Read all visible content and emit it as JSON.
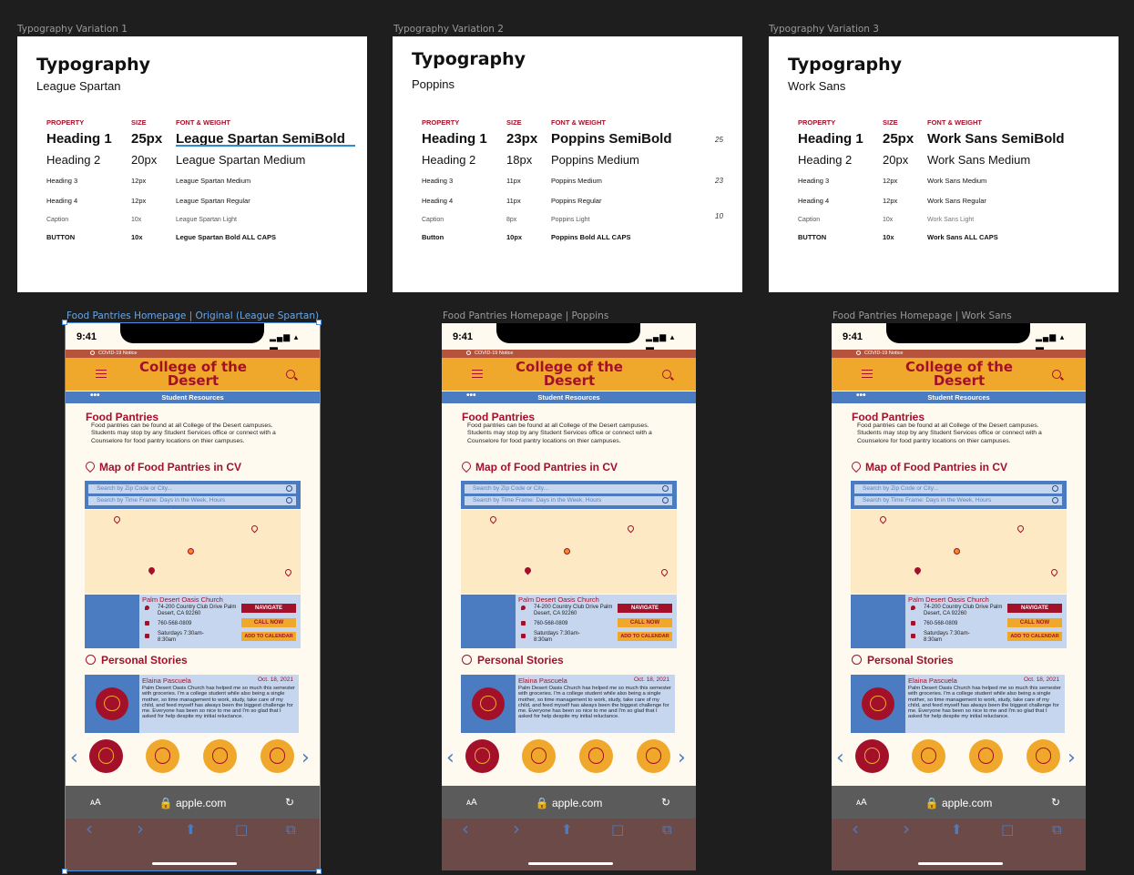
{
  "frames": {
    "typo1": "Typography Variation 1",
    "typo2": "Typography Variation 2",
    "typo3": "Typography Variation 3",
    "phone1": "Food Pantries Homepage | Original (League Spartan)",
    "phone2": "Food Pantries Homepage | Poppins",
    "phone3": "Food Pantries Homepage | Work Sans"
  },
  "cards": [
    {
      "title": "Typography",
      "font": "League Spartan",
      "headers": [
        "PROPERTY",
        "SIZE",
        "FONT & WEIGHT"
      ],
      "rows": [
        [
          "Heading 1",
          "25px",
          "League Spartan SemiBold"
        ],
        [
          "Heading 2",
          "20px",
          "League Spartan Medium"
        ],
        [
          "Heading 3",
          "12px",
          "League Spartan Medium"
        ],
        [
          "Heading 4",
          "12px",
          "League Spartan Regular"
        ],
        [
          "Caption",
          "10x",
          "League Spartan Light"
        ],
        [
          "BUTTON",
          "10x",
          "Legue Spartan Bold ALL CAPS"
        ]
      ],
      "notes": []
    },
    {
      "title": "Typography",
      "font": "Poppins",
      "headers": [
        "PROPERTY",
        "SIZE",
        "FONT & WEIGHT"
      ],
      "rows": [
        [
          "Heading 1",
          "23px",
          "Poppins SemiBold"
        ],
        [
          "Heading 2",
          "18px",
          "Poppins Medium"
        ],
        [
          "Heading 3",
          "11px",
          "Poppins Medium"
        ],
        [
          "Heading 4",
          "11px",
          "Poppins Regular"
        ],
        [
          "Caption",
          "8px",
          "Poppins Light"
        ],
        [
          "Button",
          "10px",
          "Poppins Bold ALL CAPS"
        ]
      ],
      "notes": [
        "25",
        "23",
        "10"
      ]
    },
    {
      "title": "Typography",
      "font": "Work Sans",
      "headers": [
        "PROPERTY",
        "SIZE",
        "FONT & WEIGHT"
      ],
      "rows": [
        [
          "Heading 1",
          "25px",
          "Work Sans SemiBold"
        ],
        [
          "Heading 2",
          "20px",
          "Work Sans Medium"
        ],
        [
          "Heading 3",
          "12px",
          "Work Sans Medium"
        ],
        [
          "Heading 4",
          "12px",
          "Work Sans Regular"
        ],
        [
          "Caption",
          "10x",
          "Work Sans Light"
        ],
        [
          "BUTTON",
          "10x",
          "Work Sans ALL CAPS"
        ]
      ],
      "notes": []
    }
  ],
  "phone": {
    "time": "9:41",
    "signal": "▂▄▆ ▴ ▬",
    "covid": "COVID-19 Notice",
    "title": "College of the Desert",
    "nav_dots": "•••",
    "student_resources": "Student Resources",
    "section_title": "Food Pantries",
    "intro": "Food pantries can be found at all College of the Desert campuses. Students may stop by any Student Services office or connect with a Counselore for food pantry locations on thier campuses.",
    "map_title": "Map of Food Pantries in CV",
    "search_zip": "Search by Zip Code or City...",
    "search_time": "Search by Time Frame:  Days in the Week, Hours",
    "location": {
      "name": "Palm Desert Oasis Church",
      "address": "74-200 Country Club Drive Palm Desert, CA 92260",
      "phone": "760-568-0809",
      "hours": "Saturdays 7:30am-8:30am",
      "navigate": "NAVIGATE",
      "call": "CALL NOW",
      "calendar": "ADD TO CALENDAR"
    },
    "stories_title": "Personal Stories",
    "story": {
      "name": "Elaina Pascuela",
      "date": "Oct. 18, 2021",
      "text": "Palm Desert Oasis Church has helped me so much this semester with groceries. I'm a college student while also being a single mother, so time management to work, study, take care of my child, and feed myself has always been the biggest challenge for me. Everyone has been so nice to me and I'm so glad that I asked for help despite my initial reluctance."
    },
    "arrow_left": "‹",
    "arrow_right": "›",
    "browser": {
      "aa": "ᴀA",
      "url": "🔒 apple.com",
      "reload": "↻",
      "back": "‹",
      "forward": "›",
      "share": "⬆",
      "bookmarks": "□",
      "tabs": "⧉"
    }
  },
  "colors": {
    "brand_red": "#a3102a",
    "brand_yellow": "#f0a82c",
    "brand_blue": "#4b7cc2",
    "light_blue": "#c6d6ef",
    "cream": "#fffaf0",
    "map_bg": "#fde9c4"
  }
}
